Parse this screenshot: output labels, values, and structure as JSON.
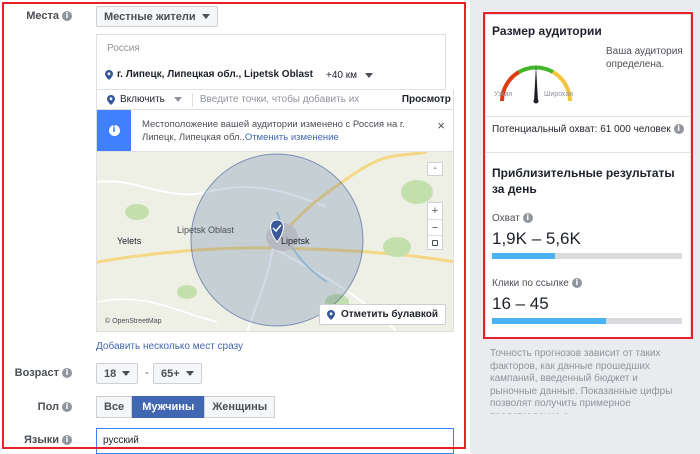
{
  "form": {
    "locations": {
      "label": "Места",
      "audience_type": "Местные жители",
      "country": "Россия",
      "city": "г. Липецк, Липецкая обл., Lipetsk Oblast",
      "radius": "+40 км",
      "include": "Включить",
      "search_placeholder": "Введите точки, чтобы добавить их",
      "browse": "Просмотр",
      "alert_text": "Местоположение вашей аудитории изменено с Россия на г. Липецк, Липецкая обл..",
      "alert_undo": "Отменить изменение",
      "add_bulk": "Добавить несколько мест сразу"
    },
    "map": {
      "city_label": "Lipetsk",
      "oblast_label": "Lipetsk Oblast",
      "yelets_label": "Yelets",
      "attribution": "© OpenStreetMap",
      "drop_pin": "Отметить булавкой",
      "zoom_in": "+",
      "zoom_out": "−",
      "collapse": "-"
    },
    "age": {
      "label": "Возраст",
      "min": "18",
      "dash": "-",
      "max": "65+"
    },
    "gender": {
      "label": "Пол",
      "options": [
        "Все",
        "Мужчины",
        "Женщины"
      ],
      "selected": "Мужчины"
    },
    "languages": {
      "label": "Языки",
      "value": "русский"
    }
  },
  "audience_size": {
    "title": "Размер аудитории",
    "status": "Ваша аудитория определена.",
    "narrow": "Узкая",
    "broad": "Широкая",
    "potential_reach": "Потенциальный охват: 61 000 человек",
    "colors": {
      "narrow": "#dd3c10",
      "defined": "#42b72a",
      "broad": "#f5c33b"
    }
  },
  "estimated_results": {
    "title": "Приблизительные результаты за день",
    "reach_label": "Охват",
    "reach_value": "1,9K – 5,6K",
    "reach_fill": 0.33,
    "clicks_label": "Клики по ссылке",
    "clicks_value": "16 – 45",
    "clicks_fill": 0.6
  },
  "disclaimer": "Точность прогнозов зависит от таких факторов, как данные прошедших кампаний, введенный бюджет и рыночные данные. Показанные цифры позволят получить примерное представление о"
}
